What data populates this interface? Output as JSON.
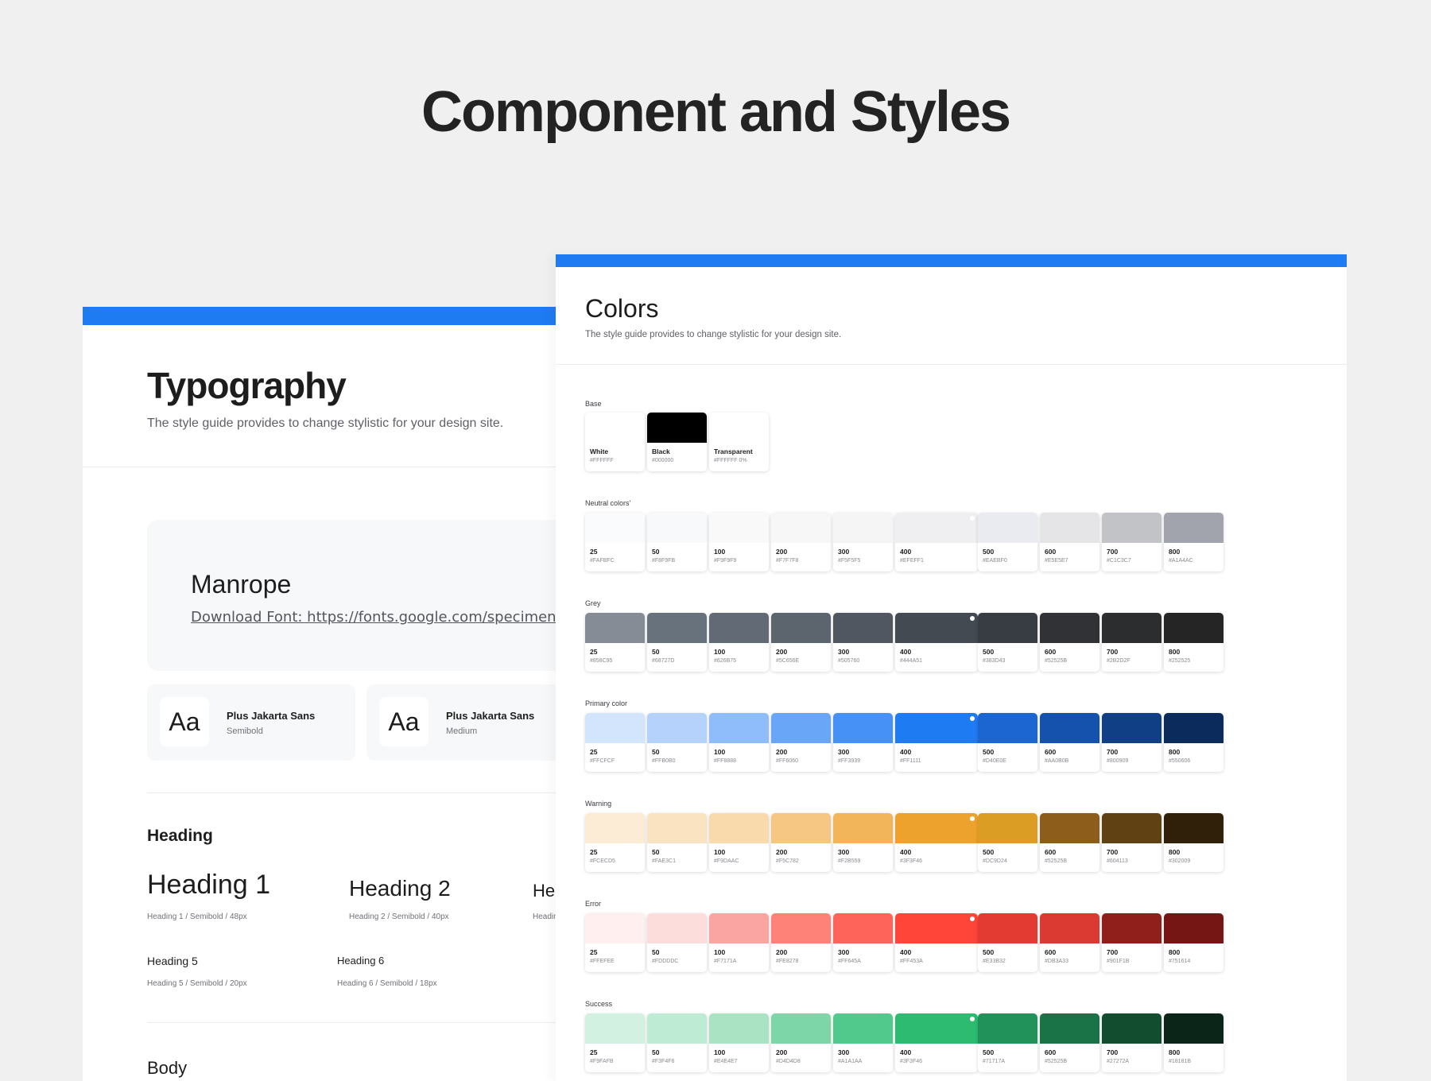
{
  "page_title": "Component and Styles",
  "typography": {
    "title": "Typography",
    "subtitle": "The style guide provides to change stylistic for your design site.",
    "font_name": "Manrope",
    "font_link": "Download Font: https://fonts.google.com/specimen/Manrope",
    "samples": [
      {
        "aa": "Aa",
        "name": "Plus Jakarta Sans",
        "weight": "Semibold"
      },
      {
        "aa": "Aa",
        "name": "Plus Jakarta Sans",
        "weight": "Medium"
      }
    ],
    "heading_section": "Heading",
    "headings": [
      {
        "label": "Heading 1",
        "note": "Heading 1 / Semibold / 48px"
      },
      {
        "label": "Heading 2",
        "note": "Heading 2 / Semibold / 40px"
      },
      {
        "label": "He",
        "note": "Headin"
      },
      {
        "label": "Heading 5",
        "note": "Heading 5 / Semibold / 20px"
      },
      {
        "label": "Heading 6",
        "note": "Heading 6 / Semibold / 18px"
      }
    ],
    "body_section": "Body"
  },
  "colors": {
    "title": "Colors",
    "subtitle": "The style guide provides to change stylistic for your design site.",
    "base": {
      "label": "Base",
      "swatches": [
        {
          "name": "White",
          "hex": "#FFFFFF",
          "color": "#FFFFFF"
        },
        {
          "name": "Black",
          "hex": "#000000",
          "color": "#000000"
        },
        {
          "name": "Transparent",
          "hex": "#FFFFFF 0%",
          "color": "#FFFFFF"
        }
      ]
    },
    "groups": [
      {
        "label": "Neutral colors'",
        "swatches": [
          {
            "name": "25",
            "hex": "#FAFBFC",
            "color": "#FAFBFC"
          },
          {
            "name": "50",
            "hex": "#F8F9FB",
            "color": "#F8F9FB"
          },
          {
            "name": "100",
            "hex": "#F9F9F9",
            "color": "#F9F9F9"
          },
          {
            "name": "200",
            "hex": "#F7F7F8",
            "color": "#F7F7F8"
          },
          {
            "name": "300",
            "hex": "#F5F5F5",
            "color": "#F5F5F5"
          },
          {
            "name": "400",
            "hex": "#EFEFF1",
            "color": "#EFEFF1"
          },
          {
            "name": "500",
            "hex": "#EAEBF0",
            "color": "#EAEBF0"
          },
          {
            "name": "600",
            "hex": "#E5E5E7",
            "color": "#E5E5E7"
          },
          {
            "name": "700",
            "hex": "#C1C3C7",
            "color": "#C1C3C7"
          },
          {
            "name": "800",
            "hex": "#A1A4AC",
            "color": "#A1A4AC"
          }
        ]
      },
      {
        "label": "Grey",
        "swatches": [
          {
            "name": "25",
            "hex": "#858C95",
            "color": "#858C95"
          },
          {
            "name": "50",
            "hex": "#68727D",
            "color": "#68727D"
          },
          {
            "name": "100",
            "hex": "#626B75",
            "color": "#626B75"
          },
          {
            "name": "200",
            "hex": "#5C656E",
            "color": "#5C656E"
          },
          {
            "name": "300",
            "hex": "#505760",
            "color": "#505760"
          },
          {
            "name": "400",
            "hex": "#444A51",
            "color": "#444A51"
          },
          {
            "name": "500",
            "hex": "#383D43",
            "color": "#383D43"
          },
          {
            "name": "600",
            "hex": "#52525B",
            "color": "#303235"
          },
          {
            "name": "700",
            "hex": "#2B2D2F",
            "color": "#2B2D2F"
          },
          {
            "name": "800",
            "hex": "#252525",
            "color": "#252525"
          }
        ]
      },
      {
        "label": "Primary color",
        "swatches": [
          {
            "name": "25",
            "hex": "#FFCFCF",
            "color": "#D3E4FD"
          },
          {
            "name": "50",
            "hex": "#FFB0B0",
            "color": "#B4D2FC"
          },
          {
            "name": "100",
            "hex": "#FF8888",
            "color": "#8FBCFA"
          },
          {
            "name": "200",
            "hex": "#FF6060",
            "color": "#6AA6F8"
          },
          {
            "name": "300",
            "hex": "#FF3939",
            "color": "#4691F6"
          },
          {
            "name": "400",
            "hex": "#FF1111",
            "color": "#1F7BF2"
          },
          {
            "name": "500",
            "hex": "#D40E0E",
            "color": "#1B66D1"
          },
          {
            "name": "600",
            "hex": "#AA0B0B",
            "color": "#1552AD"
          },
          {
            "name": "700",
            "hex": "#800909",
            "color": "#103F86"
          },
          {
            "name": "800",
            "hex": "#550606",
            "color": "#0B2B5C"
          }
        ]
      },
      {
        "label": "Warning",
        "swatches": [
          {
            "name": "25",
            "hex": "#FCECD5",
            "color": "#FCECD5"
          },
          {
            "name": "50",
            "hex": "#FAE3C1",
            "color": "#FAE3C1"
          },
          {
            "name": "100",
            "hex": "#F9DAAC",
            "color": "#F9DAAC"
          },
          {
            "name": "200",
            "hex": "#F5C782",
            "color": "#F5C782"
          },
          {
            "name": "300",
            "hex": "#F2B559",
            "color": "#F2B559"
          },
          {
            "name": "400",
            "hex": "#3F3F46",
            "color": "#EEA22E"
          },
          {
            "name": "500",
            "hex": "#DC9D24",
            "color": "#DC9D24"
          },
          {
            "name": "600",
            "hex": "#52525B",
            "color": "#8C5D1B"
          },
          {
            "name": "700",
            "hex": "#604113",
            "color": "#604113"
          },
          {
            "name": "800",
            "hex": "#302009",
            "color": "#302009"
          }
        ]
      },
      {
        "label": "Error",
        "swatches": [
          {
            "name": "25",
            "hex": "#FFEFEE",
            "color": "#FFEFEE"
          },
          {
            "name": "50",
            "hex": "#FDDDDC",
            "color": "#FDDDDC"
          },
          {
            "name": "100",
            "hex": "#F7171A",
            "color": "#FBA5A2"
          },
          {
            "name": "200",
            "hex": "#FE8278",
            "color": "#FE8278"
          },
          {
            "name": "300",
            "hex": "#FF645A",
            "color": "#FF645A"
          },
          {
            "name": "400",
            "hex": "#FF453A",
            "color": "#FF453A"
          },
          {
            "name": "500",
            "hex": "#E33B32",
            "color": "#E33B32"
          },
          {
            "name": "600",
            "hex": "#DB3A33",
            "color": "#DB3A33"
          },
          {
            "name": "700",
            "hex": "#901F1B",
            "color": "#901F1B"
          },
          {
            "name": "800",
            "hex": "#751614",
            "color": "#751614"
          }
        ]
      },
      {
        "label": "Success",
        "swatches": [
          {
            "name": "25",
            "hex": "#F9FAFB",
            "color": "#D3F1E0"
          },
          {
            "name": "50",
            "hex": "#F3F4F6",
            "color": "#BDEBD3"
          },
          {
            "name": "100",
            "hex": "#E4E4E7",
            "color": "#A9E3C4"
          },
          {
            "name": "200",
            "hex": "#D4D4D8",
            "color": "#7DD6A8"
          },
          {
            "name": "300",
            "hex": "#A1A1AA",
            "color": "#52C98C"
          },
          {
            "name": "400",
            "hex": "#3F3F46",
            "color": "#2DBB71"
          },
          {
            "name": "500",
            "hex": "#71717A",
            "color": "#21935A"
          },
          {
            "name": "600",
            "hex": "#52525B",
            "color": "#1A7346"
          },
          {
            "name": "700",
            "hex": "#27272A",
            "color": "#124D30"
          },
          {
            "name": "800",
            "hex": "#18181B",
            "color": "#0B2618"
          }
        ]
      }
    ]
  }
}
